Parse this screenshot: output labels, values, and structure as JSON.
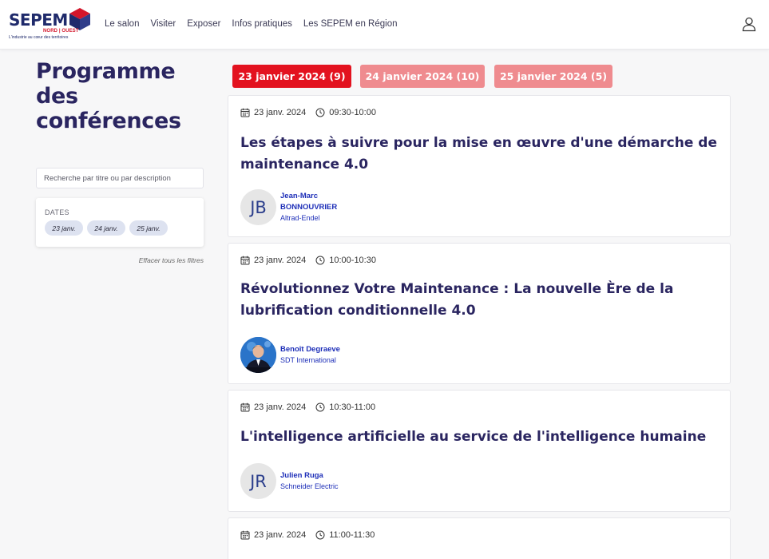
{
  "header": {
    "logo": {
      "word": "SEPEM",
      "region": "NORD | OUEST",
      "tagline": "L'industrie au cœur des territoires",
      "colors": {
        "navy": "#1f2a6b",
        "red": "#d3162b"
      }
    },
    "nav": [
      "Le salon",
      "Visiter",
      "Exposer",
      "Infos pratiques",
      "Les SEPEM en Région"
    ],
    "user_icon": "user-icon"
  },
  "sidebar": {
    "title": "Programme des conférences",
    "search_placeholder": "Recherche par titre ou par description",
    "filters": {
      "label": "DATES",
      "chips": [
        "23 janv.",
        "24 janv.",
        "25 janv."
      ]
    },
    "clear_filters": "Effacer tous les filtres"
  },
  "tabs": [
    {
      "label": "23 janvier 2024 (9)",
      "active": true
    },
    {
      "label": "24 janvier 2024 (10)",
      "active": false
    },
    {
      "label": "25 janvier 2024 (5)",
      "active": false
    }
  ],
  "colors": {
    "tab_active": "#e3121f",
    "tab_inactive": "#ef8b8f",
    "title": "#2a2560",
    "speaker_link": "#1e2fb8"
  },
  "conferences": [
    {
      "date": "23 janv. 2024",
      "time": "09:30-10:00",
      "title": "Les étapes à suivre pour la mise en œuvre d'une démarche de maintenance 4.0",
      "speaker": {
        "initials": "JB",
        "name": "Jean-Marc BONNOUVRIER",
        "company": "Altrad-Endel"
      }
    },
    {
      "date": "23 janv. 2024",
      "time": "10:00-10:30",
      "title": "Révolutionnez Votre Maintenance : La nouvelle Ère de la lubrification conditionnelle 4.0",
      "speaker": {
        "initials": "",
        "name": "Benoît Degraeve",
        "company": "SDT International"
      }
    },
    {
      "date": "23 janv. 2024",
      "time": "10:30-11:00",
      "title": "L'intelligence artificielle au service de l'intelligence humaine",
      "speaker": {
        "initials": "JR",
        "name": "Julien Ruga",
        "company": "Schneider Electric"
      }
    },
    {
      "date": "23 janv. 2024",
      "time": "11:00-11:30"
    }
  ]
}
